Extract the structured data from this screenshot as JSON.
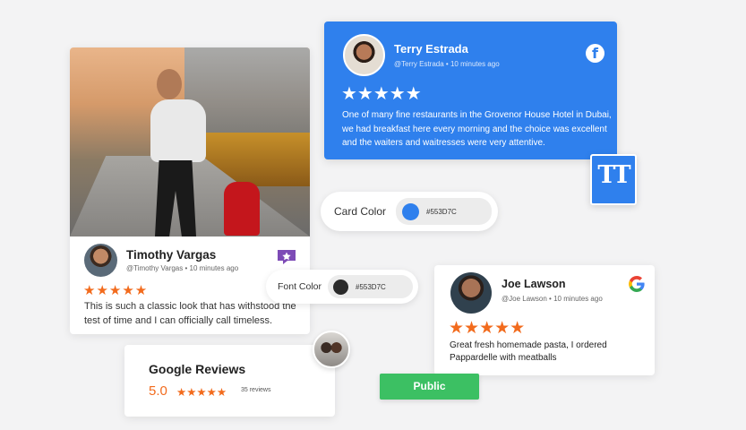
{
  "photo_review": {
    "name": "Timothy Vargas",
    "handle": "@Timothy Vargas",
    "time": "10 minutes ago",
    "stars": "★★★★★",
    "text": "This is such a classic look that has withstood the test of time and I can officially call timeless."
  },
  "facebook_review": {
    "name": "Terry Estrada",
    "handle": "@Terry Estrada",
    "time": "10 minutes ago",
    "stars": "★★★★★",
    "text": "One of many fine restaurants in the Grovenor House Hotel in Dubai, we had breakfast here every morning and the choice was excellent and the waiters  and waitresses were very attentive.",
    "card_color": "#2f80ed"
  },
  "font_tool": {
    "glyph": "TT"
  },
  "card_color_picker": {
    "label": "Card Color",
    "value": "#553D7C"
  },
  "font_color_picker": {
    "label": "Font Color",
    "value": "#553D7C"
  },
  "google_review": {
    "name": "Joe Lawson",
    "handle": "@Joe Lawson",
    "time": "10 minutes ago",
    "stars": "★★★★★",
    "text": "Great fresh homemade pasta, I ordered Pappardelle with meatballs"
  },
  "summary": {
    "title": "Google Reviews",
    "rating": "5.0",
    "stars": "★★★★★",
    "count": "35 reviews"
  },
  "public_button": {
    "label": "Public",
    "color": "#3cc063"
  },
  "accent": {
    "star_color": "#f26b1d"
  }
}
